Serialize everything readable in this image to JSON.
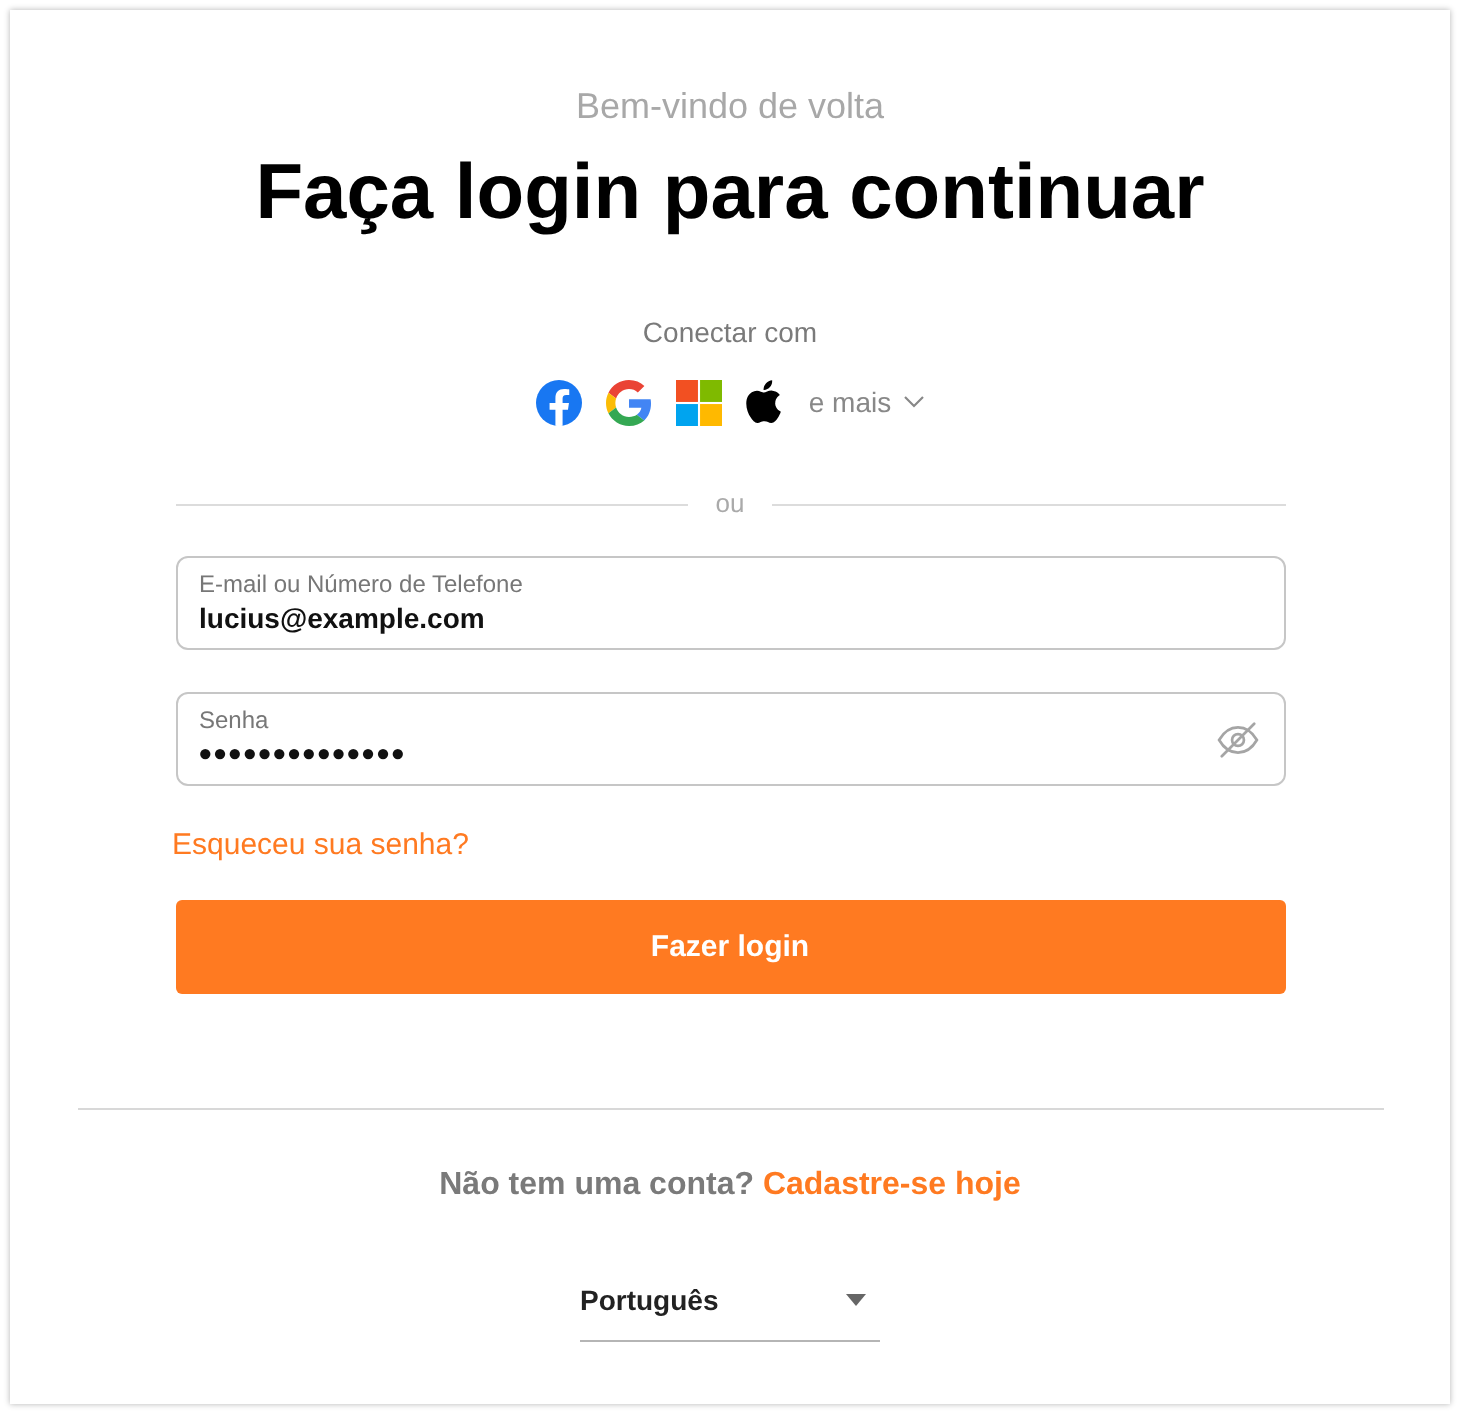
{
  "header": {
    "greeting": "Bem-vindo de volta",
    "title": "Faça login para continuar"
  },
  "social": {
    "label": "Conectar com",
    "more": "e mais"
  },
  "divider": "ou",
  "fields": [
    {
      "kind": "text",
      "label": "E-mail ou Número de Telefone",
      "value": "lucius@example.com"
    },
    {
      "kind": "password",
      "label": "Senha",
      "value": "••••••••••••••"
    }
  ],
  "forgot_link": "Esqueceu sua senha?",
  "submit_button": "Fazer login",
  "signup": {
    "prompt": "Não tem uma conta?",
    "link": "Cadastre-se hoje"
  },
  "language_select": {
    "value": "Português"
  }
}
